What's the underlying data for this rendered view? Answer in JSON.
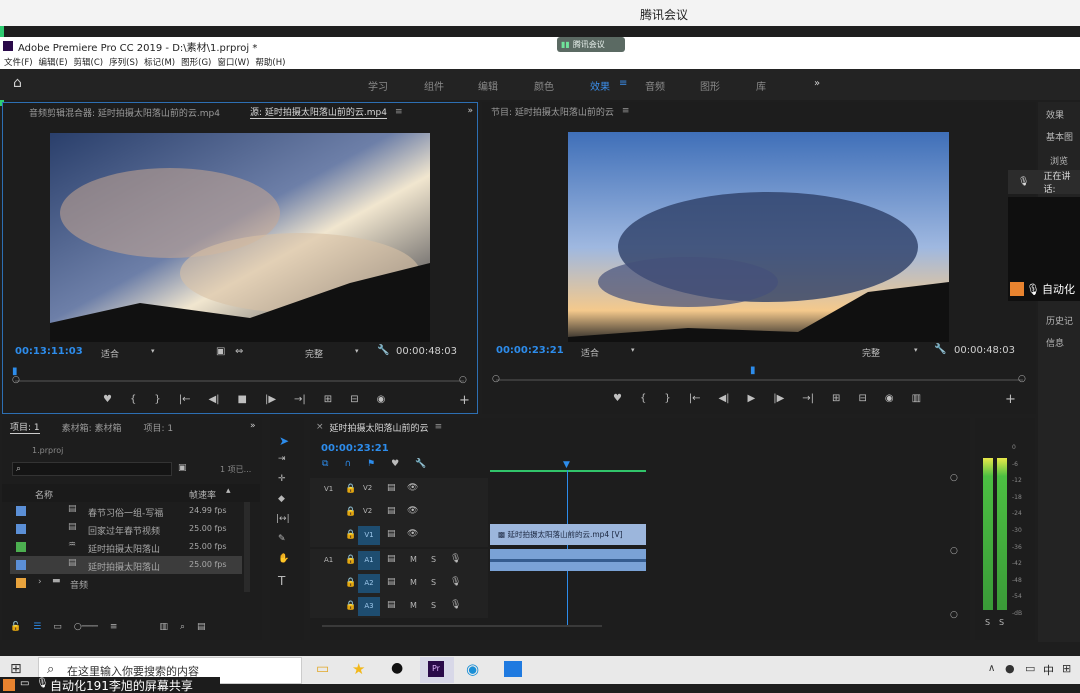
{
  "meeting": {
    "app_title": "腾讯会议",
    "pill_label": "腾讯会议",
    "speaking_label": "正在讲话:",
    "participant_label": "自动化",
    "share_label": "自动化191李旭的屏幕共享"
  },
  "window": {
    "title": "Adobe Premiere Pro CC 2019 - D:\\素材\\1.prproj *"
  },
  "menu": [
    "文件(F)",
    "编辑(E)",
    "剪辑(C)",
    "序列(S)",
    "标记(M)",
    "图形(G)",
    "窗口(W)",
    "帮助(H)"
  ],
  "workspaces": [
    "学习",
    "组件",
    "编辑",
    "颜色",
    "效果",
    "音频",
    "图形",
    "库"
  ],
  "active_workspace": "效果",
  "source_monitor": {
    "tab_audio_mixer": "音频剪辑混合器: 延时拍摄太阳落山前的云.mp4",
    "tab_source": "源: 延时拍摄太阳落山前的云.mp4",
    "timecode": "00:13:11:03",
    "fit": "适合",
    "quality": "完整",
    "duration": "00:00:48:03"
  },
  "program_monitor": {
    "title": "节目: 延时拍摄太阳落山前的云",
    "timecode": "00:00:23:21",
    "fit": "适合",
    "quality": "完整",
    "duration": "00:00:48:03"
  },
  "effects_panel": {
    "items": [
      "效果",
      "基本图",
      "浏览",
      "历史记",
      "信息"
    ]
  },
  "project_panel": {
    "tabs": [
      "项目: 1",
      "素材箱: 素材箱",
      "项目: 1"
    ],
    "project_file": "1.prproj",
    "count": "1 项已...",
    "search_placeholder": "",
    "col_name": "名称",
    "col_fps": "帧速率",
    "items": [
      {
        "name": "春节习俗一组-写福",
        "fps": "24.99 fps",
        "color": "#5b8fd6"
      },
      {
        "name": "回家过年春节视频",
        "fps": "25.00 fps",
        "color": "#5b8fd6"
      },
      {
        "name": "延时拍摄太阳落山",
        "fps": "25.00 fps",
        "color": "#4caf50"
      },
      {
        "name": "延时拍摄太阳落山",
        "fps": "25.00 fps",
        "color": "#5b8fd6"
      }
    ],
    "folder": {
      "name": "音频",
      "color": "#e8a33d"
    }
  },
  "timeline": {
    "sequence_name": "延时拍摄太阳落山前的云",
    "timecode": "00:00:23:21",
    "video_tracks": [
      "V2",
      "V2",
      "V1"
    ],
    "audio_tracks": [
      "A1",
      "A2",
      "A3"
    ],
    "v1_label": "V1",
    "a1_label": "A1",
    "clip_label": "延时拍摄太阳落山前的云.mp4 [V]"
  },
  "audio_meter": {
    "scale": [
      "0",
      "-6",
      "-12",
      "-18",
      "-24",
      "-30",
      "-36",
      "-42",
      "-48",
      "-54",
      "-dB"
    ],
    "solo_left": "S",
    "solo_right": "S"
  },
  "taskbar": {
    "search_placeholder": "在这里输入你要搜索的内容",
    "ime": "中"
  }
}
